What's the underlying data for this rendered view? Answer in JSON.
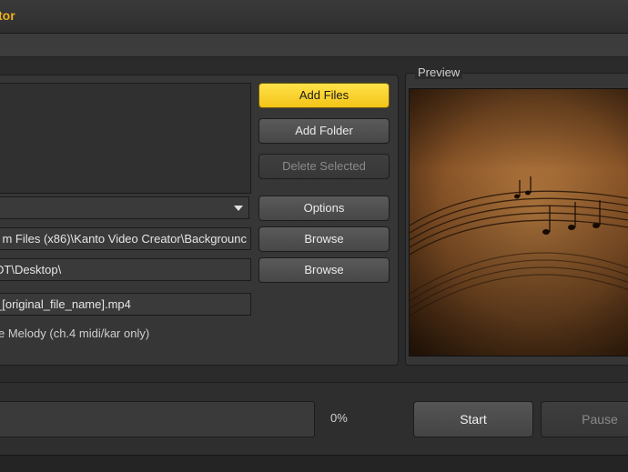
{
  "window": {
    "title": "tor"
  },
  "buttons": {
    "add_files": "Add Files",
    "add_folder": "Add Folder",
    "delete_selected": "Delete Selected",
    "options": "Options",
    "browse_background": "Browse",
    "browse_output": "Browse",
    "start": "Start",
    "pause": "Pause"
  },
  "fields": {
    "background_path": "m Files (x86)\\Kanto Video Creator\\Backgrounc",
    "output_folder": "DT\\Desktop\\",
    "file_name_pattern": "_[original_file_name].mp4"
  },
  "melody_option": "e Melody (ch.4 midi/kar only)",
  "preview": {
    "label": "Preview"
  },
  "progress": {
    "percent_text": "0%",
    "value": 0
  },
  "colors": {
    "accent": "#f3c417",
    "title": "#f0b020",
    "background": "#2b2b2b"
  }
}
